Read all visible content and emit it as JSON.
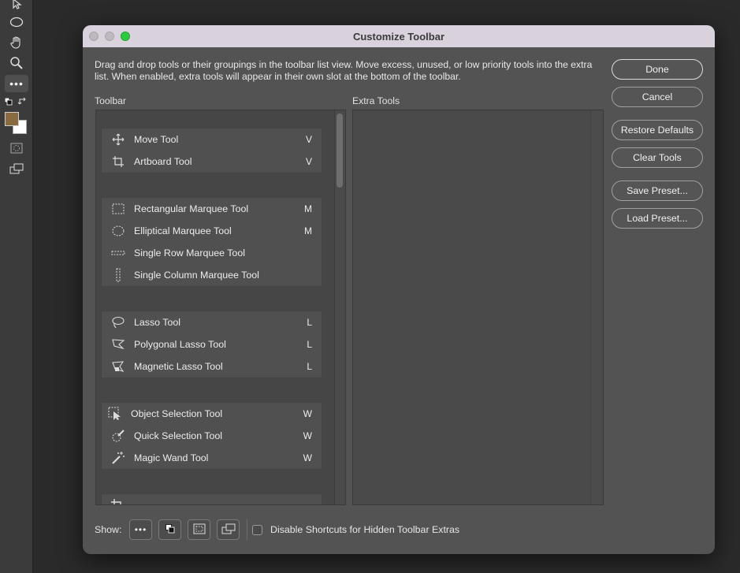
{
  "dialog": {
    "title": "Customize Toolbar",
    "description": "Drag and drop tools or their groupings in the toolbar list view. Move excess, unused, or low priority tools into the extra list. When enabled, extra tools will appear in their own slot at the bottom of the toolbar.",
    "toolbar_label": "Toolbar",
    "extra_label": "Extra Tools"
  },
  "groups": [
    {
      "tools": [
        {
          "name": "Move Tool",
          "key": "V",
          "icon": "move-icon"
        },
        {
          "name": "Artboard Tool",
          "key": "V",
          "icon": "artboard-icon"
        }
      ]
    },
    {
      "tools": [
        {
          "name": "Rectangular Marquee Tool",
          "key": "M",
          "icon": "rect-marquee-icon"
        },
        {
          "name": "Elliptical Marquee Tool",
          "key": "M",
          "icon": "ellipse-marquee-icon"
        },
        {
          "name": "Single Row Marquee Tool",
          "key": "",
          "icon": "row-marquee-icon"
        },
        {
          "name": "Single Column Marquee Tool",
          "key": "",
          "icon": "column-marquee-icon"
        }
      ]
    },
    {
      "tools": [
        {
          "name": "Lasso Tool",
          "key": "L",
          "icon": "lasso-icon"
        },
        {
          "name": "Polygonal Lasso Tool",
          "key": "L",
          "icon": "polygonal-lasso-icon"
        },
        {
          "name": "Magnetic Lasso Tool",
          "key": "L",
          "icon": "magnetic-lasso-icon"
        }
      ]
    },
    {
      "tools": [
        {
          "name": "Object Selection Tool",
          "key": "W",
          "icon": "object-selection-icon"
        },
        {
          "name": "Quick Selection Tool",
          "key": "W",
          "icon": "quick-selection-icon"
        },
        {
          "name": "Magic Wand Tool",
          "key": "W",
          "icon": "magic-wand-icon"
        }
      ]
    }
  ],
  "buttons": {
    "done": "Done",
    "cancel": "Cancel",
    "restore": "Restore Defaults",
    "clear": "Clear Tools",
    "save_preset": "Save Preset...",
    "load_preset": "Load Preset..."
  },
  "footer": {
    "show_label": "Show:",
    "show_buttons": [
      "more-tools-icon",
      "default-colors-icon",
      "quick-mask-icon",
      "screen-mode-icon"
    ],
    "checkbox_label": "Disable Shortcuts for Hidden Toolbar Extras",
    "checkbox_checked": false
  },
  "colors": {
    "foreground": "#8a6b3f",
    "background": "#ffffff",
    "dialog_bg": "#535353",
    "titlebar_bg": "#d9d2dc"
  }
}
